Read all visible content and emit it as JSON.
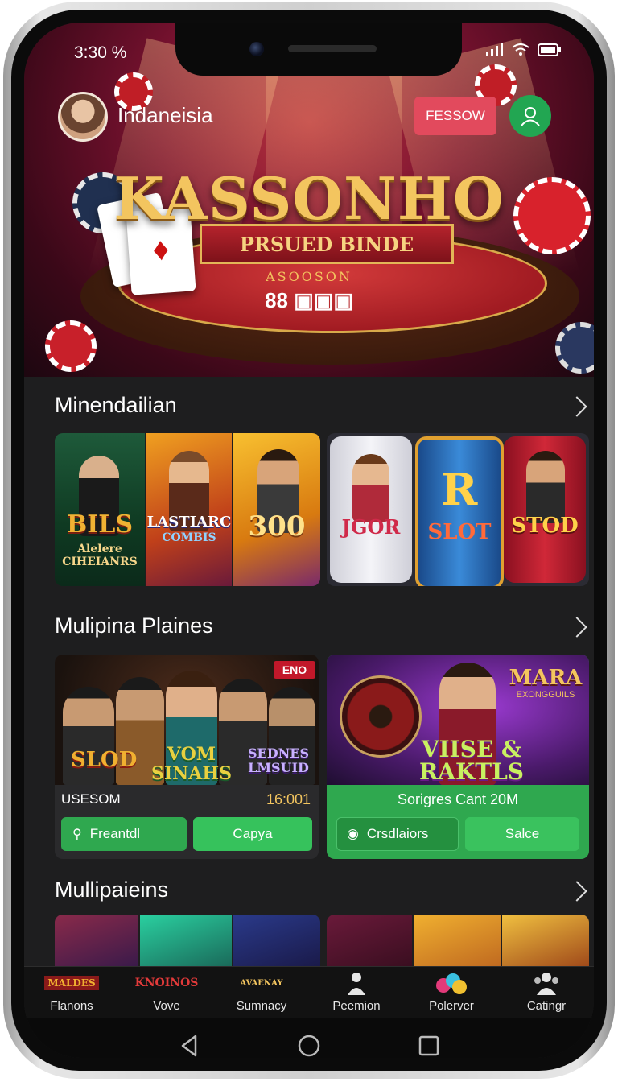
{
  "status": {
    "time": "3:30 %"
  },
  "header": {
    "username": "Indaneisia",
    "follow_label": "FESSOW"
  },
  "hero": {
    "logo": "KASSONHO",
    "ribbon": "PRSUED BINDE",
    "felt_text": "ASOOSON",
    "felt_dice": "88 ▣▣▣"
  },
  "sections": [
    {
      "title": "Minendailian"
    },
    {
      "title": "Mulipina Plaines"
    },
    {
      "title": "Mullipaieins"
    }
  ],
  "row1": {
    "tiles": [
      {
        "title": "BILS",
        "subtitle": "Alelere CIHEIANRS"
      },
      {
        "title": "LASTIARC",
        "subtitle": "COMBIS"
      },
      {
        "title": "300",
        "subtitle": ""
      }
    ],
    "reels": [
      {
        "title": "JGOR"
      },
      {
        "title": "R",
        "subtitle": "SLOT"
      },
      {
        "title": "STOD"
      }
    ]
  },
  "row2": {
    "left": {
      "badge": "ENO",
      "titles": [
        "SLOD",
        "VOM SINAHS",
        "SEDNES LMSUID"
      ],
      "caption": "USESOM",
      "time": "16:001",
      "btn1": "Freantdl",
      "btn2": "Capya"
    },
    "right": {
      "badge": "MARA",
      "badge_sub": "EXONGGUILS",
      "title": "VIISE & RAKTLS",
      "caption": "Sorigres Cant 20M",
      "btn1": "Crsdlaiors",
      "btn2": "Salce"
    }
  },
  "nav": [
    {
      "logo": "MALDES",
      "label": "Flanons"
    },
    {
      "logo": "KNOINOS",
      "label": "Vove"
    },
    {
      "logo": "AVAENAY",
      "label": "Sumnacy"
    },
    {
      "logo": "",
      "label": "Peemion"
    },
    {
      "logo": "",
      "label": "Polerver"
    },
    {
      "logo": "",
      "label": "Catingr"
    }
  ],
  "colors": {
    "accent_red": "#e24a5d",
    "accent_green": "#22a652",
    "card_green": "#2fa84f",
    "bg": "#1e1e1f"
  }
}
